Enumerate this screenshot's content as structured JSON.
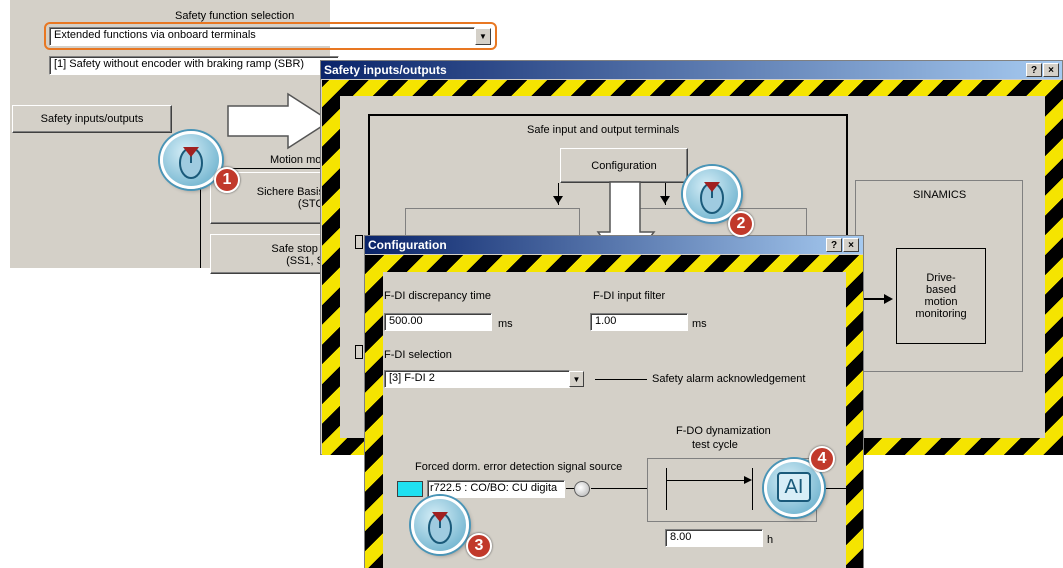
{
  "base": {
    "safety_function_title": "Safety function selection",
    "function_dropdown": "Extended functions via onboard terminals",
    "sbr_field": "[1] Safety without encoder with braking ramp (SBR)",
    "safety_io_button": "Safety inputs/outputs",
    "motion_label": "Motion mo",
    "sichere_button_line1": "Sichere Basis",
    "sichere_button_line2": "(STO",
    "safe_stop_line1": "Safe stop f",
    "safe_stop_line2": "(SS1, S"
  },
  "safety_io_window": {
    "title": "Safety inputs/outputs",
    "help_btn": "?",
    "close_btn": "×",
    "terminals_title": "Safe input and output terminals",
    "configuration_button": "Configuration",
    "sinamics_label": "SINAMICS",
    "drive_box_text": "Drive-\nbased\nmotion\nmonitoring"
  },
  "config_window": {
    "title": "Configuration",
    "help_btn": "?",
    "close_btn": "×",
    "discrepancy_label": "F-DI discrepancy time",
    "discrepancy_value": "500.00",
    "discrepancy_unit": "ms",
    "filter_label": "F-DI input filter",
    "filter_value": "1.00",
    "filter_unit": "ms",
    "selection_label": "F-DI selection",
    "selection_value": "[3]  F-DI 2",
    "ack_label": "Safety alarm acknowledgement",
    "fdo_title_line1": "F-DO dynamization",
    "fdo_title_line2": "test cycle",
    "forced_label": "Forced dorm. error detection signal source",
    "source_value": "r722.5 : CO/BO: CU digita",
    "test_cycle_value": "8.00",
    "test_cycle_unit": "h",
    "ai_button": "AI"
  },
  "markers": [
    "1",
    "2",
    "3",
    "4"
  ],
  "colors": {
    "highlight_border": "#e87722",
    "title_gradient_start": "#0a246a",
    "hazard_yellow": "#f5e400",
    "marker_red": "#c1392b",
    "cyan_button": "#20e0f0"
  }
}
